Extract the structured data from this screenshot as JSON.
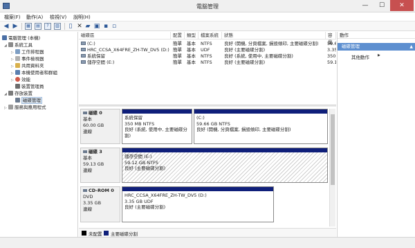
{
  "window": {
    "title": "電腦管理",
    "min": "—",
    "max": "☐",
    "close": "✕"
  },
  "menu": [
    "檔案(F)",
    "動作(A)",
    "檢視(V)",
    "說明(H)"
  ],
  "tree": {
    "root": "電腦管理 (本機)",
    "system_tools": "系統工具",
    "task_scheduler": "工作排程器",
    "event_viewer": "事件檢視器",
    "shared_folders": "共用資料夾",
    "local_users": "本機使用者和群組",
    "performance": "效能",
    "device_manager": "裝置管理員",
    "storage": "存放裝置",
    "disk_management": "磁碟管理",
    "services_apps": "服務與應用程式"
  },
  "volume_table": {
    "headers": [
      "磁碟區",
      "配置",
      "類型",
      "檔案系統",
      "狀態",
      "容量"
    ],
    "rows": [
      {
        "name": "(C:)",
        "layout": "簡單",
        "type": "基本",
        "fs": "NTFS",
        "status": "良好 (開機, 分頁檔案, 損毀傾印, 主要磁碟分割)",
        "capacity": "59.6"
      },
      {
        "name": "HRC_CCSA_X64FRE_ZH-TW_DV5 (D:)",
        "layout": "簡單",
        "type": "基本",
        "fs": "UDF",
        "status": "良好 (主要磁碟分割)",
        "capacity": "3.35"
      },
      {
        "name": "系統保留",
        "layout": "簡單",
        "type": "基本",
        "fs": "NTFS",
        "status": "良好 (系統, 使用中, 主要磁碟分割)",
        "capacity": "350"
      },
      {
        "name": "儲存空間 (E:)",
        "layout": "簡單",
        "type": "基本",
        "fs": "NTFS",
        "status": "良好 (主要磁碟分割)",
        "capacity": "59.1"
      }
    ]
  },
  "disks": [
    {
      "name": "磁碟 0",
      "type": "基本",
      "size": "60.00 GB",
      "state": "連線",
      "partitions": [
        {
          "name": "系統保留",
          "size": "350 MB NTFS",
          "status": "良好 (系統, 使用中, 主要磁碟分割)"
        },
        {
          "name": "(C:)",
          "size": "59.66 GB NTFS",
          "status": "良好 (開機, 分頁檔案, 損毀傾印, 主要磁碟分割)"
        }
      ]
    },
    {
      "name": "磁碟 3",
      "type": "基本",
      "size": "59.13 GB",
      "state": "連線",
      "partitions": [
        {
          "name": "儲存空間 (E:)",
          "size": "59.12 GB NTFS",
          "status": "良好 (主要磁碟分割)"
        }
      ]
    },
    {
      "name": "CD-ROM 0",
      "type": "DVD",
      "size": "3.35 GB",
      "state": "連線",
      "partitions": [
        {
          "name": "HRC_CCSA_X64FRE_ZH-TW_DV5 (D:)",
          "size": "3.35 GB UDF",
          "status": "良好 (主要磁碟分割)"
        }
      ]
    }
  ],
  "legend": {
    "unallocated": "未配置",
    "primary": "主要磁碟分割"
  },
  "actions": {
    "header": "動作",
    "section": "磁碟管理",
    "more": "其他動作"
  },
  "colors": {
    "partition_bar": "#0f1f7a",
    "section_header": "#5d8fd0",
    "close_button": "#c75050"
  }
}
